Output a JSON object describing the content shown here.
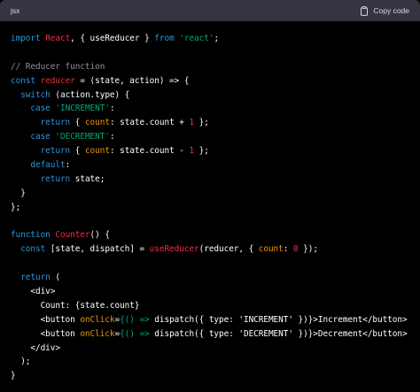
{
  "header": {
    "language": "jsx",
    "copy_label": "Copy code",
    "copy_icon": "clipboard-icon"
  },
  "colors": {
    "header_bg": "#343541",
    "code_bg": "#000000",
    "plain": "#ffffff",
    "keyword": "#2e95d3",
    "function": "#f22c3d",
    "string": "#00a67d",
    "number": "#df3079",
    "comment": "#8e8ea0",
    "attribute": "#e9950c"
  },
  "code": {
    "lines": [
      [
        [
          "kw",
          "import"
        ],
        [
          "plain",
          " "
        ],
        [
          "fn",
          "React"
        ],
        [
          "plain",
          ", { useReducer } "
        ],
        [
          "kw",
          "from"
        ],
        [
          "plain",
          " "
        ],
        [
          "str",
          "'react'"
        ],
        [
          "plain",
          ";"
        ]
      ],
      [],
      [
        [
          "cmt",
          "// Reducer function"
        ]
      ],
      [
        [
          "kw",
          "const"
        ],
        [
          "plain",
          " "
        ],
        [
          "fn",
          "reducer"
        ],
        [
          "plain",
          " = (state, action) => {"
        ]
      ],
      [
        [
          "plain",
          "  "
        ],
        [
          "kw",
          "switch"
        ],
        [
          "plain",
          " (action.type) {"
        ]
      ],
      [
        [
          "plain",
          "    "
        ],
        [
          "kw",
          "case"
        ],
        [
          "plain",
          " "
        ],
        [
          "str",
          "'INCREMENT'"
        ],
        [
          "plain",
          ":"
        ]
      ],
      [
        [
          "plain",
          "      "
        ],
        [
          "kw",
          "return"
        ],
        [
          "plain",
          " { "
        ],
        [
          "attr",
          "count"
        ],
        [
          "plain",
          ": state.count + "
        ],
        [
          "num",
          "1"
        ],
        [
          "plain",
          " };"
        ]
      ],
      [
        [
          "plain",
          "    "
        ],
        [
          "kw",
          "case"
        ],
        [
          "plain",
          " "
        ],
        [
          "str",
          "'DECREMENT'"
        ],
        [
          "plain",
          ":"
        ]
      ],
      [
        [
          "plain",
          "      "
        ],
        [
          "kw",
          "return"
        ],
        [
          "plain",
          " { "
        ],
        [
          "attr",
          "count"
        ],
        [
          "plain",
          ": state.count - "
        ],
        [
          "num",
          "1"
        ],
        [
          "plain",
          " };"
        ]
      ],
      [
        [
          "plain",
          "    "
        ],
        [
          "kw",
          "default"
        ],
        [
          "plain",
          ":"
        ]
      ],
      [
        [
          "plain",
          "      "
        ],
        [
          "kw",
          "return"
        ],
        [
          "plain",
          " state;"
        ]
      ],
      [
        [
          "plain",
          "  }"
        ]
      ],
      [
        [
          "plain",
          "};"
        ]
      ],
      [],
      [
        [
          "kw",
          "function"
        ],
        [
          "plain",
          " "
        ],
        [
          "fn",
          "Counter"
        ],
        [
          "plain",
          "() {"
        ]
      ],
      [
        [
          "plain",
          "  "
        ],
        [
          "kw",
          "const"
        ],
        [
          "plain",
          " [state, dispatch] = "
        ],
        [
          "fn",
          "useReducer"
        ],
        [
          "plain",
          "(reducer, { "
        ],
        [
          "attr",
          "count"
        ],
        [
          "plain",
          ": "
        ],
        [
          "num",
          "0"
        ],
        [
          "plain",
          " });"
        ]
      ],
      [],
      [
        [
          "plain",
          "  "
        ],
        [
          "kw",
          "return"
        ],
        [
          "plain",
          " ("
        ]
      ],
      [
        [
          "plain",
          "    <div>"
        ]
      ],
      [
        [
          "plain",
          "      Count: {state.count}"
        ]
      ],
      [
        [
          "plain",
          "      <button "
        ],
        [
          "attr",
          "onClick"
        ],
        [
          "plain",
          "="
        ],
        [
          "str",
          "{() =>"
        ],
        [
          "plain",
          " dispatch({ type: 'INCREMENT' })}>Increment</button>"
        ]
      ],
      [
        [
          "plain",
          "      <button "
        ],
        [
          "attr",
          "onClick"
        ],
        [
          "plain",
          "="
        ],
        [
          "str",
          "{() =>"
        ],
        [
          "plain",
          " dispatch({ type: 'DECREMENT' })}>Decrement</button>"
        ]
      ],
      [
        [
          "plain",
          "    </div>"
        ]
      ],
      [
        [
          "plain",
          "  );"
        ]
      ],
      [
        [
          "plain",
          "}"
        ]
      ]
    ]
  }
}
